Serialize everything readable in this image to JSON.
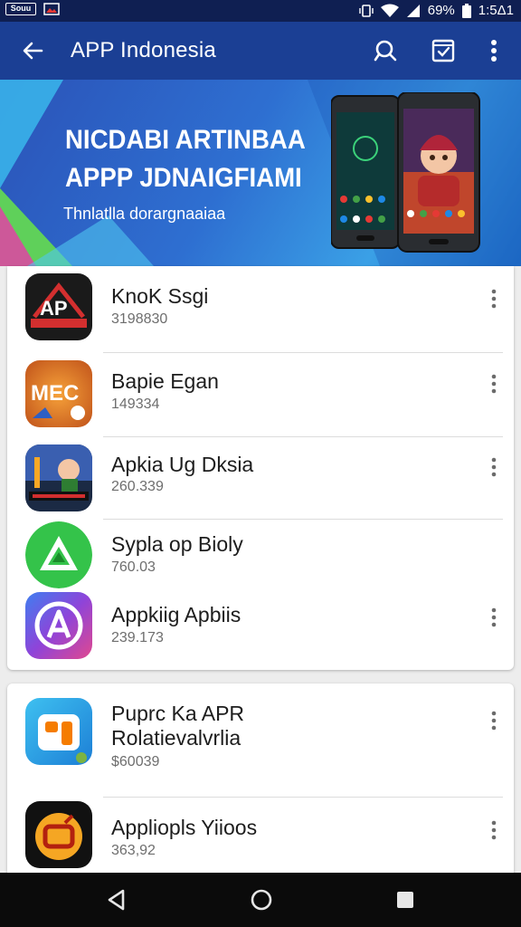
{
  "status_bar": {
    "carrier_badge": "Souu",
    "battery_percent": "69%",
    "time": "1:5Δ1",
    "icons": [
      "sim-card-icon",
      "image-notification-icon",
      "vibrate-icon",
      "wifi-icon",
      "signal-icon",
      "battery-icon"
    ]
  },
  "app_bar": {
    "title": "APP Indonesia",
    "icons": [
      "back-arrow-icon",
      "search-icon",
      "checkbox-icon",
      "more-vert-icon"
    ]
  },
  "banner": {
    "title_line1": "NICDABI ARTINBAA",
    "title_line2": "APPP JDNAIGFIAMI",
    "subtitle": "Thnlatlla dorargnaaiaa"
  },
  "apps": [
    {
      "name": "KnoK Ssgi",
      "meta": "3198830",
      "icon": "app-icon-ap"
    },
    {
      "name": "Bapie Egan",
      "meta": "149334",
      "icon": "app-icon-mec"
    },
    {
      "name": "Apkia Ug Dksia",
      "meta": "260.339",
      "icon": "app-icon-cartoon"
    },
    {
      "name": "Sypla op Bioly",
      "meta": "760.03",
      "icon": "app-icon-green-triangle"
    },
    {
      "name": "Appkiig Apbiis",
      "meta": "239.173",
      "icon": "app-icon-a-circle"
    },
    {
      "name_line1": "Puprc Ka APR",
      "name_line2": "Rolatievalvrlia",
      "meta": "$60039",
      "icon": "app-icon-orange-blue"
    },
    {
      "name": "Appliopls Yiioos",
      "meta": "363,92",
      "icon": "app-icon-orange-tv"
    }
  ],
  "nav_bar": {
    "icons": [
      "back-triangle-icon",
      "home-circle-icon",
      "recents-square-icon"
    ]
  },
  "colors": {
    "status_bar": "#0f1f52",
    "app_bar": "#1b3f94",
    "banner": "#2e6fd1",
    "background": "#ededed",
    "nav_bar": "#0b0b0b"
  }
}
